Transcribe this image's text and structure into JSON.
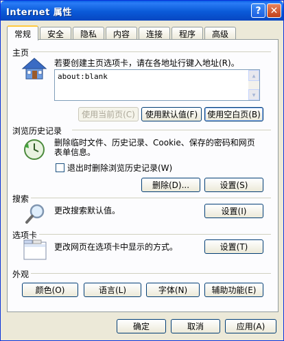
{
  "window": {
    "title": "Internet 属性"
  },
  "title_buttons": {
    "help": "?",
    "close": "✕"
  },
  "tabs": [
    "常规",
    "安全",
    "隐私",
    "内容",
    "连接",
    "程序",
    "高级"
  ],
  "homepage": {
    "section": "主页",
    "description": "若要创建主页选项卡，请在各地址行键入地址(R)。",
    "address": "about:blank",
    "btn_current": "使用当前页(C)",
    "btn_default": "使用默认值(F)",
    "btn_blank": "使用空白页(B)"
  },
  "history": {
    "section": "浏览历史记录",
    "description_1": "删除临时文件、历史记录、Cookie、保存的密码和网页",
    "description_2": "表单信息。",
    "checkbox_label": "退出时删除浏览历史记录(W)",
    "btn_delete": "删除(D)...",
    "btn_settings": "设置(S)"
  },
  "search": {
    "section": "搜索",
    "description": "更改搜索默认值。",
    "btn_settings": "设置(I)"
  },
  "tabs_section": {
    "section": "选项卡",
    "description": "更改网页在选项卡中显示的方式。",
    "btn_settings": "设置(T)"
  },
  "appearance": {
    "section": "外观",
    "btn_colors": "颜色(O)",
    "btn_languages": "语言(L)",
    "btn_fonts": "字体(N)",
    "btn_accessibility": "辅助功能(E)"
  },
  "footer": {
    "btn_ok": "确定",
    "btn_cancel": "取消",
    "btn_apply": "应用(A)"
  }
}
